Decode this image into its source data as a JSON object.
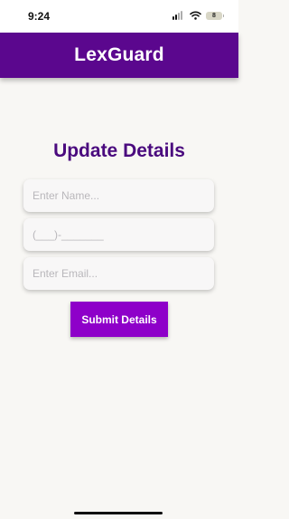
{
  "status_bar": {
    "time": "9:24",
    "battery_level": "8",
    "icons": [
      "signal-icon",
      "wifi-icon",
      "battery-icon"
    ]
  },
  "header": {
    "title": "LexGuard",
    "background_color": "#5b078e"
  },
  "form": {
    "title": "Update Details",
    "name_placeholder": "Enter Name...",
    "phone_placeholder": "(___)-_______",
    "email_placeholder": "Enter Email...",
    "submit_label": "Submit Details",
    "submit_color": "#8e00c9",
    "title_color": "#4a0a7e"
  }
}
